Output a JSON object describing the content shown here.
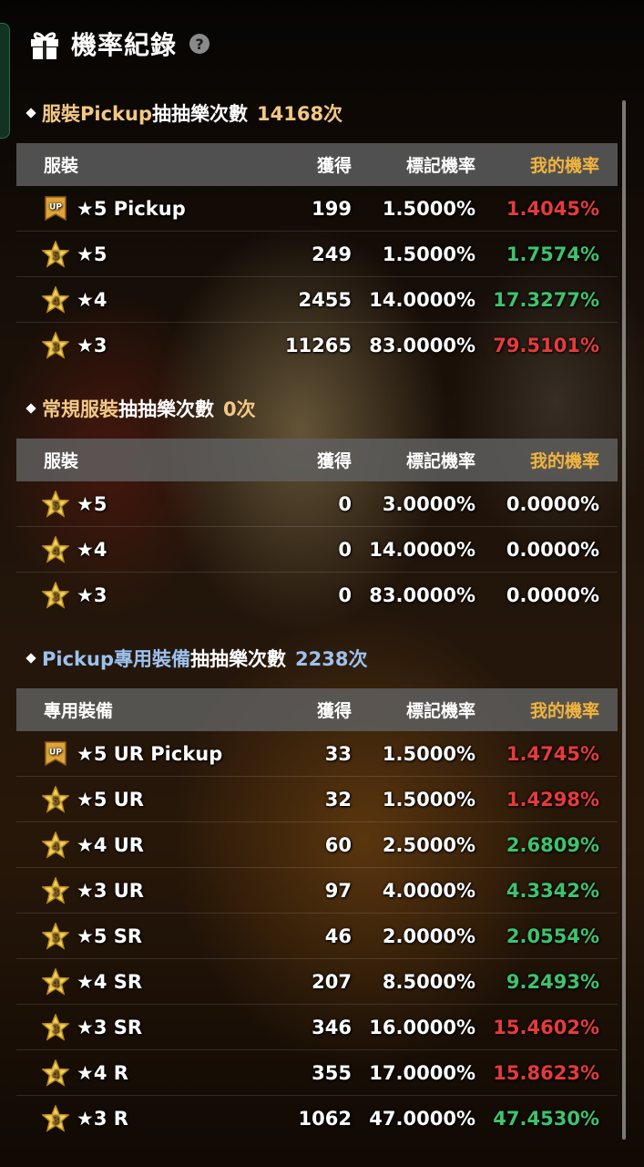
{
  "header": {
    "title": "機率紀錄",
    "help": "?"
  },
  "colors": {
    "red": "#e63b3b",
    "green": "#3fc36b",
    "white": "#ffffff",
    "gold": "#f1b43f",
    "highlight": "#f3c885",
    "highlight_blue": "#9cc1ee"
  },
  "sections": [
    {
      "title_highlight": "服裝Pickup",
      "title_mid": "抽抽樂次數",
      "title_count": "14168次",
      "highlight_color": "highlight",
      "head": {
        "name": "服裝",
        "get": "獲得",
        "rate": "標記機率",
        "mine": "我的機率"
      },
      "rows": [
        {
          "icon": "up-badge-icon",
          "name": "★5 Pickup",
          "get": "199",
          "rate": "1.5000%",
          "mine": "1.4045%",
          "color": "red"
        },
        {
          "icon": "star-5-icon",
          "star": "5",
          "name": "★5",
          "get": "249",
          "rate": "1.5000%",
          "mine": "1.7574%",
          "color": "green"
        },
        {
          "icon": "star-4-icon",
          "star": "4",
          "name": "★4",
          "get": "2455",
          "rate": "14.0000%",
          "mine": "17.3277%",
          "color": "green"
        },
        {
          "icon": "star-3-icon",
          "star": "3",
          "name": "★3",
          "get": "11265",
          "rate": "83.0000%",
          "mine": "79.5101%",
          "color": "red"
        }
      ]
    },
    {
      "title_highlight": "常規服裝",
      "title_mid": "抽抽樂次數",
      "title_count": "0次",
      "highlight_color": "highlight",
      "head": {
        "name": "服裝",
        "get": "獲得",
        "rate": "標記機率",
        "mine": "我的機率"
      },
      "rows": [
        {
          "icon": "star-5-icon",
          "star": "5",
          "name": "★5",
          "get": "0",
          "rate": "3.0000%",
          "mine": "0.0000%",
          "color": "white"
        },
        {
          "icon": "star-4-icon",
          "star": "4",
          "name": "★4",
          "get": "0",
          "rate": "14.0000%",
          "mine": "0.0000%",
          "color": "white"
        },
        {
          "icon": "star-3-icon",
          "star": "3",
          "name": "★3",
          "get": "0",
          "rate": "83.0000%",
          "mine": "0.0000%",
          "color": "white"
        }
      ]
    },
    {
      "title_highlight": "Pickup專用裝備",
      "title_mid": "抽抽樂次數",
      "title_count": "2238次",
      "highlight_color": "highlight_blue",
      "head": {
        "name": "專用裝備",
        "get": "獲得",
        "rate": "標記機率",
        "mine": "我的機率"
      },
      "rows": [
        {
          "icon": "up-badge-icon",
          "name": "★5 UR Pickup",
          "get": "33",
          "rate": "1.5000%",
          "mine": "1.4745%",
          "color": "red"
        },
        {
          "icon": "star-5-icon",
          "star": "5",
          "name": "★5 UR",
          "get": "32",
          "rate": "1.5000%",
          "mine": "1.4298%",
          "color": "red"
        },
        {
          "icon": "star-4-icon",
          "star": "4",
          "name": "★4 UR",
          "get": "60",
          "rate": "2.5000%",
          "mine": "2.6809%",
          "color": "green"
        },
        {
          "icon": "star-3-icon",
          "star": "3",
          "name": "★3 UR",
          "get": "97",
          "rate": "4.0000%",
          "mine": "4.3342%",
          "color": "green"
        },
        {
          "icon": "star-5-icon",
          "star": "5",
          "name": "★5 SR",
          "get": "46",
          "rate": "2.0000%",
          "mine": "2.0554%",
          "color": "green"
        },
        {
          "icon": "star-4-icon",
          "star": "4",
          "name": "★4 SR",
          "get": "207",
          "rate": "8.5000%",
          "mine": "9.2493%",
          "color": "green"
        },
        {
          "icon": "star-3-icon",
          "star": "3",
          "name": "★3 SR",
          "get": "346",
          "rate": "16.0000%",
          "mine": "15.4602%",
          "color": "red"
        },
        {
          "icon": "star-4-icon",
          "star": "4",
          "name": "★4 R",
          "get": "355",
          "rate": "17.0000%",
          "mine": "15.8623%",
          "color": "red"
        },
        {
          "icon": "star-3-icon",
          "star": "3",
          "name": "★3 R",
          "get": "1062",
          "rate": "47.0000%",
          "mine": "47.4530%",
          "color": "green"
        }
      ]
    }
  ]
}
